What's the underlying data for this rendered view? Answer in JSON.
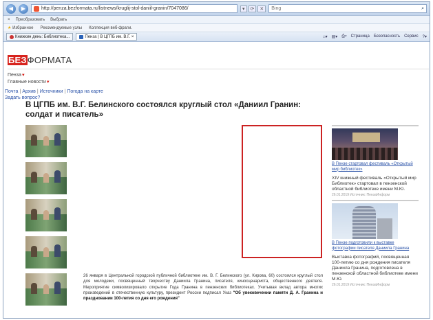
{
  "browser": {
    "url": "http://penza.bezformata.ru/listnews/kruglij-stol-daniil-granin/7047086/",
    "search_placeholder": "Bing",
    "row2": [
      "Преобразовать",
      "Выбрать"
    ],
    "row3": [
      "Избранное",
      "Рекомендуемые узлы",
      "Коллекция веб-фрагм."
    ],
    "tabs": [
      "Книжкин день: Библиотека...",
      "Пенза | В ЦГПБ им. В.Г. ×"
    ],
    "commands": [
      "Страница",
      "Безопасность",
      "Сервис"
    ]
  },
  "site": {
    "logo_red": "БЕЗ",
    "logo_rest": "ФОРМАТА",
    "city": "Пенза",
    "main_news": "Главные новости",
    "links": [
      "Почта",
      "Архив",
      "Источники",
      "Погода на карте"
    ],
    "ask": "Задать вопрос?"
  },
  "article": {
    "title": "В ЦГПБ им. В.Г. Белинского состоялся круглый стол «Даниил Гранин: солдат и писатель»",
    "body": "26 января в Центральной городской публичной библиотеке им. В. Г. Белинского (ул. Кирова, 60) состоялся круглый стол для молодежи, посвященный творчеству Даниила Гранина, писателя, киносценариста, общественного деятеля. Мероприятие символизировало открытие Года Гранина в пензенских библиотеках. Учитывая вклад автора многих произведений в отечественную культуру, президент России подписал Указ",
    "body_bold": "\"Об увековечении памяти Д. А. Гранина и праздновании 100-летия со дня его рождения\""
  },
  "sidebar": {
    "items": [
      {
        "link": "В Пензе стартовал фестиваль «Открытый мир библиотек»",
        "text": "XIV книжный фестиваль «Открытый мир Библиотек» стартовал в пензенской областной библиотеке имени М.Ю.",
        "date": "26.01.2019 Источник: ПензаИнформ"
      },
      {
        "link": "В Пензе подготовили к выставке фотографии писателя Даниила Гранина",
        "text": "Выставка фотографий, посвященная 100-летию со дня рождения писателя Даниила Гранина, подготовлена в пензенской областной библиотеке имени М.Ю.",
        "date": "26.01.2019 Источник: ПензаИнформ"
      }
    ]
  }
}
